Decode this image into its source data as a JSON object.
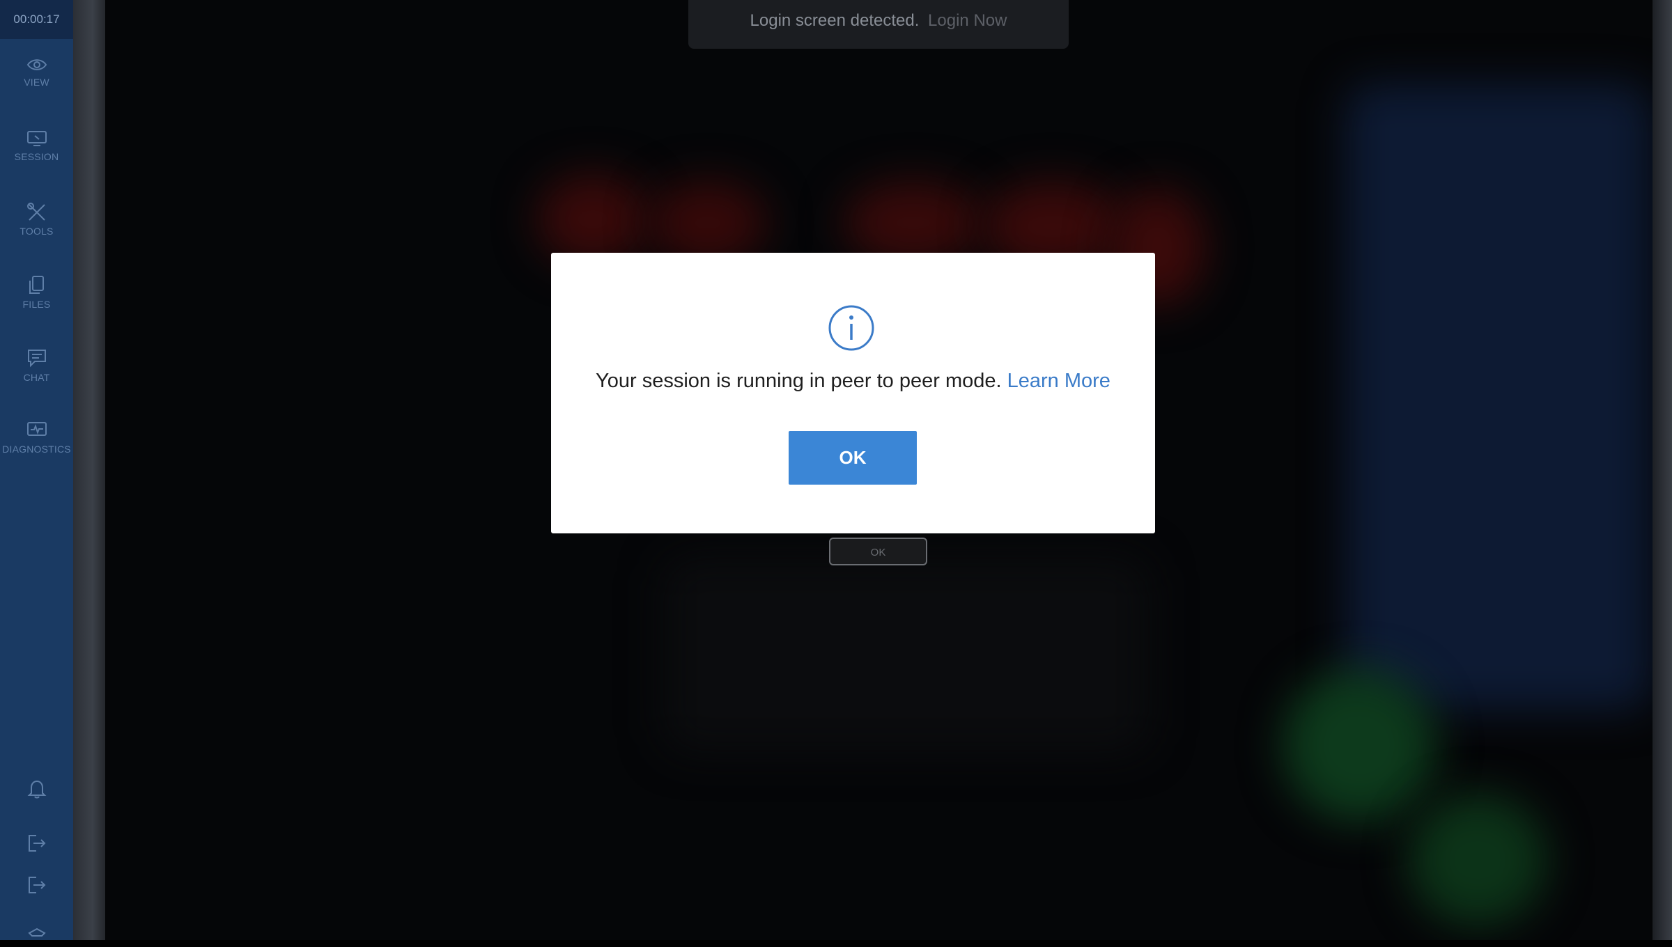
{
  "sidebar": {
    "timer": "00:00:17",
    "items": [
      {
        "label": "VIEW",
        "icon": "eye-icon"
      },
      {
        "label": "SESSION",
        "icon": "monitor-icon"
      },
      {
        "label": "TOOLS",
        "icon": "tools-icon"
      },
      {
        "label": "FILES",
        "icon": "files-icon"
      },
      {
        "label": "CHAT",
        "icon": "chat-icon"
      },
      {
        "label": "DIAGNOSTICS",
        "icon": "diagnostics-icon"
      }
    ],
    "bottom_icons": [
      "bell-icon",
      "exit-icon",
      "logout-icon",
      "settings-icon"
    ]
  },
  "notification": {
    "text": "Login screen detected.",
    "link": "Login Now"
  },
  "background": {
    "ok_label": "OK"
  },
  "dialog": {
    "icon": "info-icon",
    "message": "Your session is running in peer to peer mode.",
    "link": "Learn More",
    "ok_label": "OK"
  },
  "colors": {
    "sidebar": "#1a3a63",
    "accent": "#3b86d6",
    "link": "#3a7bc8"
  }
}
